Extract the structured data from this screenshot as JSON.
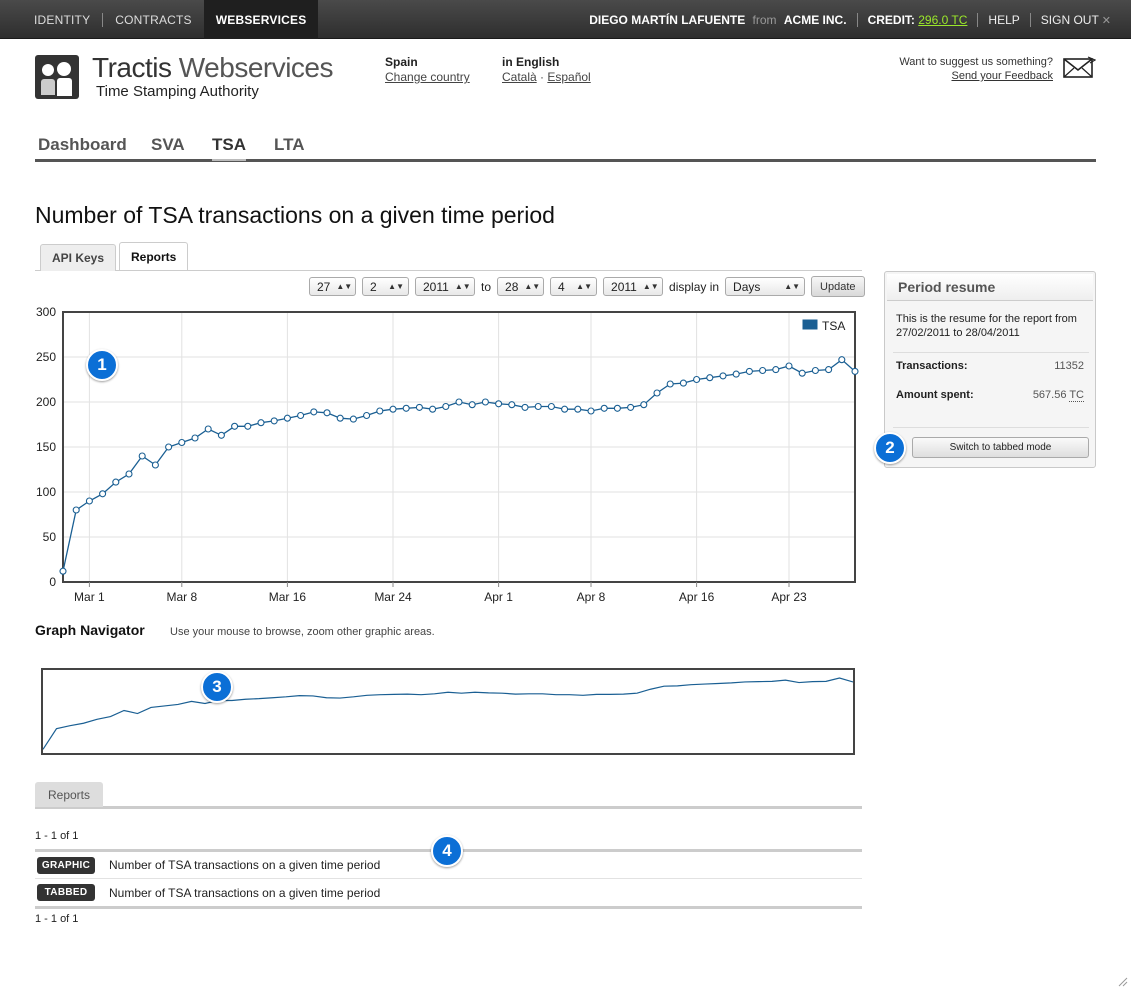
{
  "topbar": {
    "tabs": [
      {
        "label": "IDENTITY",
        "active": false
      },
      {
        "label": "CONTRACTS",
        "active": false
      },
      {
        "label": "WEBSERVICES",
        "active": true
      }
    ],
    "user": "DIEGO MARTÍN LAFUENTE",
    "from": "from",
    "company": "ACME INC.",
    "credit_label": "CREDIT:",
    "credit_value": "296.0 TC",
    "help": "HELP",
    "signout": "SIGN OUT"
  },
  "header": {
    "brand_main": "Tractis",
    "brand_light": " Webservices",
    "subtitle": "Time Stamping Authority",
    "country_label": "Spain",
    "country_link": "Change country",
    "lang_label": "in English",
    "lang_link_1": "Català",
    "lang_sep": " · ",
    "lang_link_2": "Español",
    "feedback_text": "Want to suggest us something?",
    "feedback_link": "Send your Feedback"
  },
  "section_nav": [
    "Dashboard",
    "SVA",
    "TSA",
    "LTA"
  ],
  "active_section": "TSA",
  "page_title": "Number of TSA transactions on a given time period",
  "subtabs": [
    "API Keys",
    "Reports"
  ],
  "active_subtab": "Reports",
  "controls": {
    "from_day": "27",
    "from_month": "2",
    "from_year": "2011",
    "to_label": "to",
    "to_day": "28",
    "to_month": "4",
    "to_year": "2011",
    "display_label": "display in",
    "unit": "Days",
    "update": "Update"
  },
  "chart_data": {
    "type": "line",
    "series": [
      {
        "name": "TSA",
        "color": "#1a5f93",
        "start": "2011-02-27",
        "end": "2011-04-28",
        "values": [
          12,
          80,
          90,
          98,
          111,
          120,
          140,
          130,
          150,
          155,
          160,
          170,
          163,
          173,
          173,
          177,
          179,
          182,
          185,
          189,
          188,
          182,
          181,
          185,
          190,
          192,
          193,
          194,
          192,
          195,
          200,
          197,
          200,
          198,
          197,
          194,
          195,
          195,
          192,
          192,
          190,
          193,
          193,
          194,
          197,
          210,
          220,
          221,
          225,
          227,
          229,
          231,
          234,
          235,
          236,
          240,
          232,
          235,
          236,
          247,
          234
        ]
      }
    ],
    "x_ticks": [
      "Mar 1",
      "Mar 8",
      "Mar 16",
      "Mar 24",
      "Apr 1",
      "Apr 8",
      "Apr 16",
      "Apr 23"
    ],
    "y_ticks": [
      "0",
      "50",
      "100",
      "150",
      "200",
      "250",
      "300"
    ],
    "ylim": [
      0,
      300
    ],
    "grid": true,
    "legend": "top-right"
  },
  "badges": [
    "1",
    "2",
    "3",
    "4"
  ],
  "resume": {
    "title": "Period resume",
    "description": "This is the resume for the report from 27/02/2011 to 28/04/2011",
    "transactions_label": "Transactions:",
    "transactions_value": "11352",
    "amount_label": "Amount spent:",
    "amount_value": "567.56",
    "amount_unit": "TC",
    "switch_button": "Switch to tabbed mode"
  },
  "navigator": {
    "title": "Graph Navigator",
    "hint": "Use your mouse to browse, zoom other graphic areas."
  },
  "reports": {
    "tab": "Reports",
    "pager_top": "1 - 1 of 1",
    "pager_bottom": "1 - 1 of 1",
    "rows": [
      {
        "tag": "GRAPHIC",
        "name": "Number of TSA transactions on a given time period"
      },
      {
        "tag": "TABBED",
        "name": "Number of TSA transactions on a given time period"
      }
    ]
  }
}
